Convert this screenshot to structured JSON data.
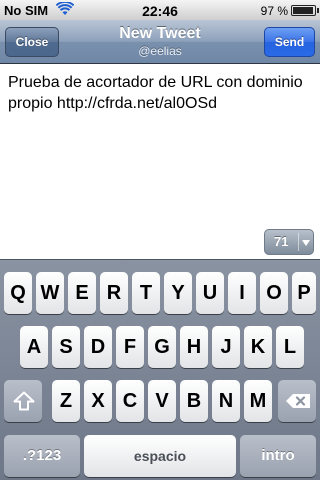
{
  "status": {
    "carrier": "No SIM",
    "time": "22:46",
    "battery": "97 %"
  },
  "nav": {
    "close_label": "Close",
    "title": "New Tweet",
    "subtitle": "@eelias",
    "send_label": "Send"
  },
  "compose": {
    "text": "Prueba de acortador de URL con dominio propio http://cfrda.net/al0OSd",
    "char_count": "71"
  },
  "keyboard": {
    "row1": [
      "Q",
      "W",
      "E",
      "R",
      "T",
      "Y",
      "U",
      "I",
      "O",
      "P"
    ],
    "row2": [
      "A",
      "S",
      "D",
      "F",
      "G",
      "H",
      "J",
      "K",
      "L"
    ],
    "row3": [
      "Z",
      "X",
      "C",
      "V",
      "B",
      "N",
      "M"
    ],
    "numbers_label": ".?123",
    "space_label": "espacio",
    "return_label": "intro"
  }
}
